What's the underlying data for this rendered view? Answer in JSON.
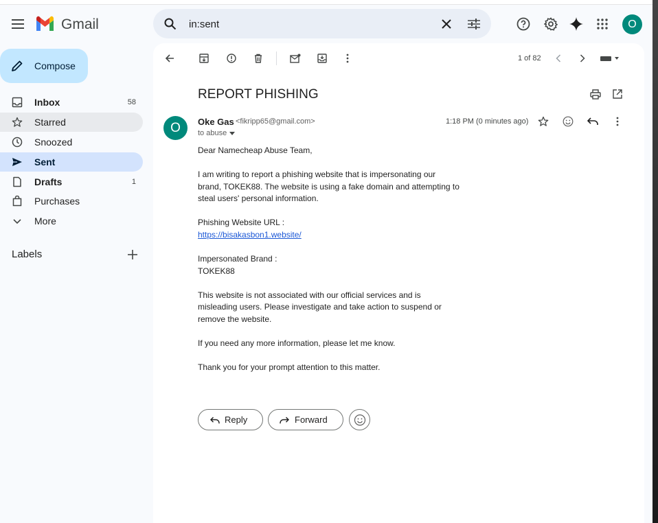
{
  "app": {
    "name": "Gmail"
  },
  "search": {
    "query": "in:sent"
  },
  "user": {
    "initial": "O"
  },
  "sidebar": {
    "compose_label": "Compose",
    "items": [
      {
        "label": "Inbox",
        "count": "58"
      },
      {
        "label": "Starred",
        "count": ""
      },
      {
        "label": "Snoozed",
        "count": ""
      },
      {
        "label": "Sent",
        "count": ""
      },
      {
        "label": "Drafts",
        "count": "1"
      },
      {
        "label": "Purchases",
        "count": ""
      },
      {
        "label": "More",
        "count": ""
      }
    ],
    "labels_title": "Labels"
  },
  "toolbar": {
    "pager": "1 of 82"
  },
  "message": {
    "subject": "REPORT PHISHING",
    "sender_initial": "O",
    "sender_name": "Oke Gas",
    "sender_email": "<fikripp65@gmail.com>",
    "to_line": "to abuse",
    "time": "1:18 PM (0 minutes ago)",
    "greeting": "Dear Namecheap Abuse Team,",
    "para1_line1": "I am writing to report a phishing website that is impersonating our",
    "para1_line2": "brand, TOKEK88. The website is using a fake domain and attempting to",
    "para1_line3": "steal users' personal information.",
    "url_label": "Phishing Website URL :",
    "url": "https://bisakasbon1.website/",
    "brand_label": "Impersonated Brand :",
    "brand": "TOKEK88",
    "para2_line1": "This website is not associated with our official services and is",
    "para2_line2": "misleading users. Please investigate and take action to suspend or",
    "para2_line3": "remove the website.",
    "para3": "If you need any more information, please let me know.",
    "para4": "Thank you for your prompt attention to this matter."
  },
  "actions": {
    "reply_label": "Reply",
    "forward_label": "Forward"
  },
  "colors": {
    "accent": "#c2e7ff",
    "active_nav": "#d3e3fd",
    "avatar": "#00897b",
    "link": "#1a57d6"
  }
}
